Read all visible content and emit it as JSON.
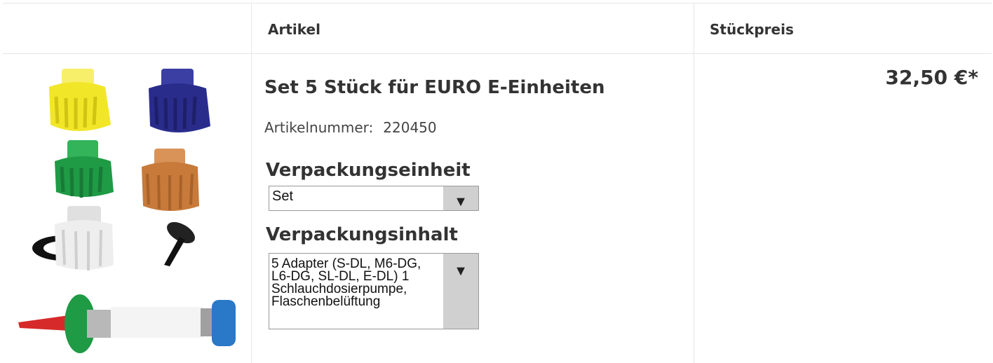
{
  "table": {
    "header": {
      "article": "Artikel",
      "unit_price": "Stückpreis"
    }
  },
  "product": {
    "name": "Set 5 Stück für EURO E-Einheiten",
    "article_number_label": "Artikelnummer:",
    "article_number": "220450",
    "packaging_unit_label": "Verpackungseinheit",
    "packaging_unit_value": "Set",
    "packaging_content_label": "Verpackungsinhalt",
    "packaging_content_value": "5 Adapter (S-DL, M6-DG,\nL6-DG, SL-DL, E-DL) 1\nSchlauchdosierpumpe,\nFlaschenbelüftung",
    "price": "32,50 €*"
  },
  "icons": {
    "dropdown_arrow": "▼"
  },
  "colors": {
    "adapter_yellow": "#f2e628",
    "adapter_blue": "#2a2c8c",
    "adapter_green": "#1f9a45",
    "adapter_copper": "#c77a3a",
    "adapter_white": "#eeeeee",
    "pump_blue": "#2a78c8",
    "pump_red": "#d62a2a"
  }
}
